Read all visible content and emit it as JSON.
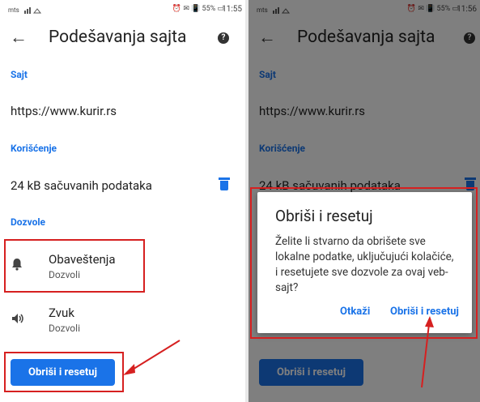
{
  "colors": {
    "accent": "#1a73e8",
    "highlight": "#d62020",
    "scrim": "rgba(0,0,0,0.5)"
  },
  "left": {
    "status": {
      "carrier": "mts",
      "indicators": "⏰ ✉ 📳 55% ▭",
      "clock": "11:55"
    },
    "appbar": {
      "back_icon": "arrow-back-icon",
      "title": "Podešavanja sajta",
      "help_icon": "help-icon"
    },
    "sections": {
      "site_header": "Sajt",
      "site_url": "https://www.kurir.rs",
      "usage_header": "Korišćenje",
      "usage_text": "24 kB sačuvanih podataka",
      "permissions_header": "Dozvole"
    },
    "permissions": [
      {
        "icon": "bell-icon",
        "title": "Obaveštenja",
        "value": "Dozvoli"
      },
      {
        "icon": "speaker-icon",
        "title": "Zvuk",
        "value": "Dozvoli"
      }
    ],
    "button_label": "Obriši i resetuj"
  },
  "right": {
    "status": {
      "carrier": "mts",
      "indicators": "⏰ ✉ 📳 55% ▭",
      "clock": "11:56"
    },
    "appbar": {
      "title": "Podešavanja sajta"
    },
    "sections": {
      "site_header": "Sajt",
      "site_url": "https://www.kurir.rs",
      "usage_header": "Korišćenje",
      "usage_text": "24 kB sačuvanih podataka"
    },
    "button_label": "Obriši i resetuj",
    "dialog": {
      "title": "Obriši i resetuj",
      "body": "Želite li stvarno da obrišete sve lokalne podatke, uključujući kolačiće, i resetujete sve dozvole za ovaj veb-sajt?",
      "cancel_label": "Otkaži",
      "confirm_label": "Obriši i resetuj"
    }
  }
}
